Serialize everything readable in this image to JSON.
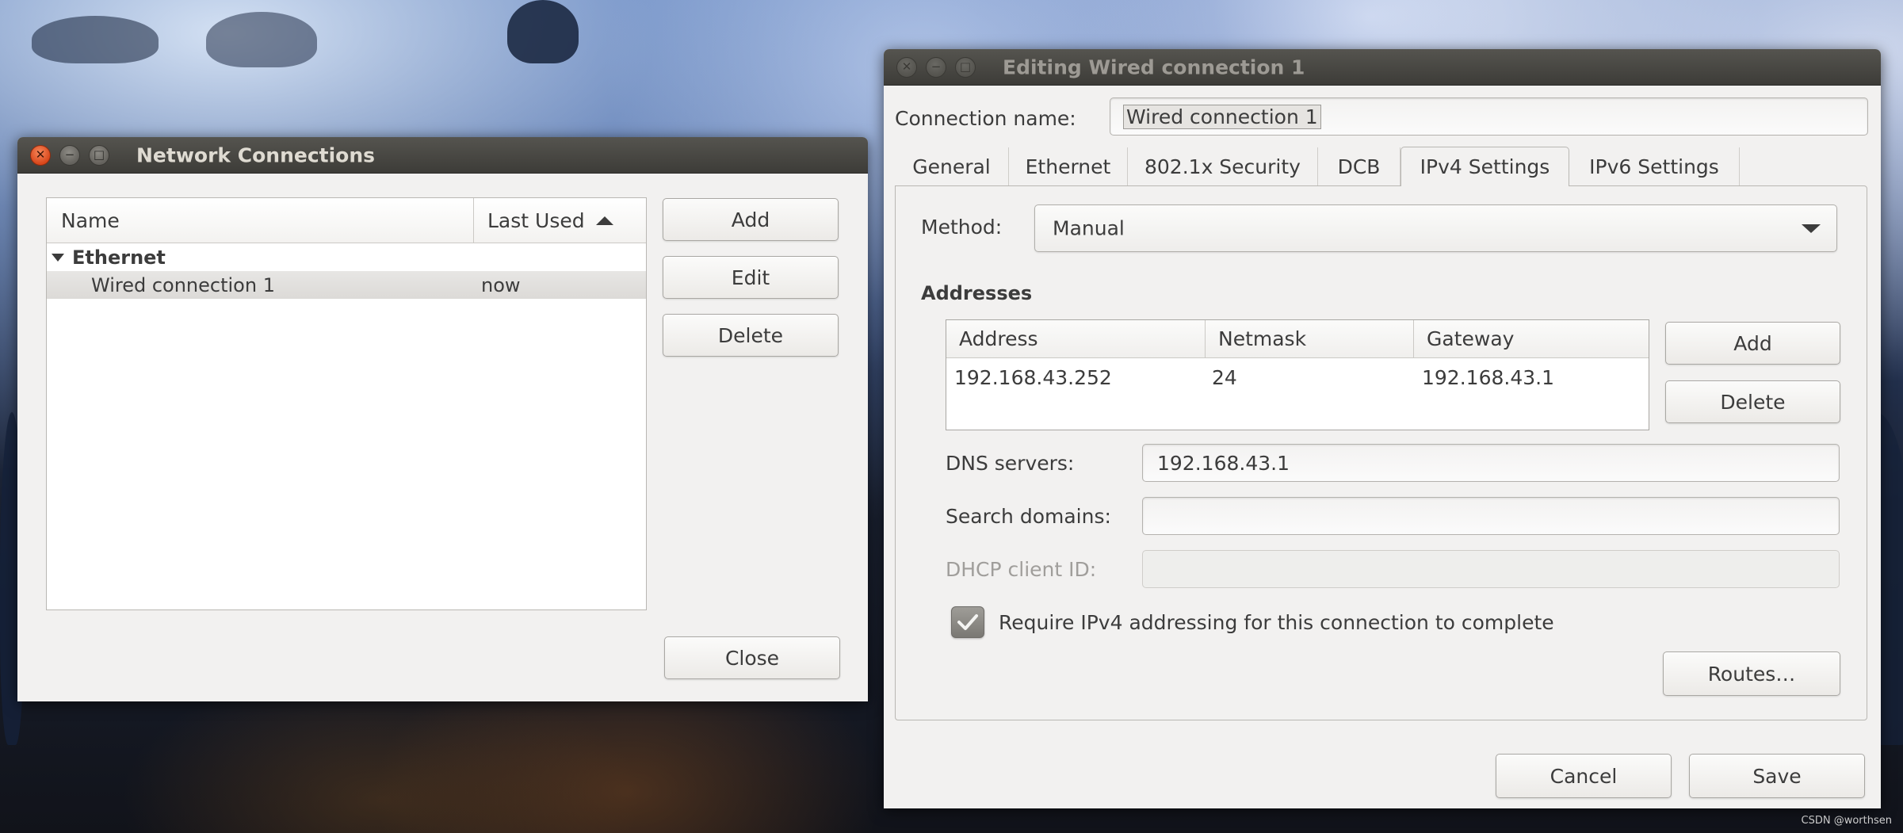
{
  "wallpaper": {
    "credit": "CSDN @worthsen"
  },
  "network_connections": {
    "title": "Network Connections",
    "columns": {
      "name": "Name",
      "last_used": "Last Used"
    },
    "group": "Ethernet",
    "rows": [
      {
        "name": "Wired connection 1",
        "last_used": "now"
      }
    ],
    "buttons": {
      "add": "Add",
      "edit": "Edit",
      "delete": "Delete",
      "close": "Close"
    }
  },
  "editor": {
    "title": "Editing Wired connection 1",
    "connection_name_label": "Connection name:",
    "connection_name": "Wired connection 1",
    "tabs": [
      "General",
      "Ethernet",
      "802.1x Security",
      "DCB",
      "IPv4 Settings",
      "IPv6 Settings"
    ],
    "active_tab": "IPv4 Settings",
    "method_label": "Method:",
    "method": "Manual",
    "addresses_heading": "Addresses",
    "address_columns": {
      "address": "Address",
      "netmask": "Netmask",
      "gateway": "Gateway"
    },
    "addresses": [
      {
        "address": "192.168.43.252",
        "netmask": "24",
        "gateway": "192.168.43.1"
      }
    ],
    "address_buttons": {
      "add": "Add",
      "delete": "Delete"
    },
    "dns_label": "DNS servers:",
    "dns_value": "192.168.43.1",
    "search_domains_label": "Search domains:",
    "search_domains_value": "",
    "dhcp_client_id_label": "DHCP client ID:",
    "dhcp_client_id_value": "",
    "require_ipv4_label": "Require IPv4 addressing for this connection to complete",
    "require_ipv4_checked": true,
    "routes_button": "Routes…",
    "cancel_button": "Cancel",
    "save_button": "Save"
  }
}
